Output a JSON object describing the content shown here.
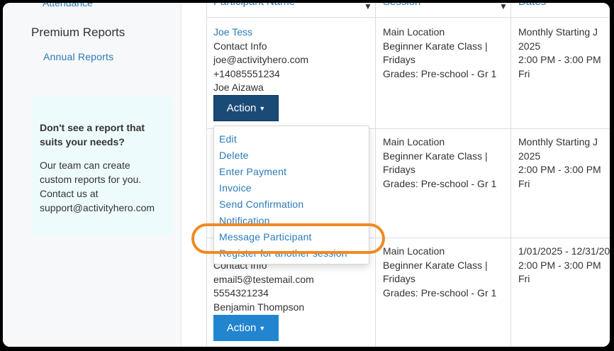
{
  "sidebar": {
    "cut_item": "Attendance",
    "heading": "Premium Reports",
    "link": "Annual Reports",
    "callout_title": "Don't see a report that suits your needs?",
    "callout_body": "Our team can create custom reports for you. Contact us at support@activityhero.com"
  },
  "table": {
    "headers": [
      "Participant Name",
      "Session",
      "Dates"
    ],
    "rows": [
      {
        "name": "Joe Tess",
        "contact_label": "Contact Info",
        "email": "joe@activityhero.com",
        "phone": "+14085551234",
        "guardian": "Joe Aizawa",
        "session_location": "Main Location",
        "session_class1": "Beginner Karate Class |",
        "session_class2": "Fridays",
        "session_grades": "Grades: Pre-school - Gr 1",
        "dates_line1": "Monthly Starting J",
        "dates_line2": "2025",
        "dates_line3": "2:00 PM - 3:00 PM",
        "dates_line4": "Fri"
      },
      {
        "session_location": "Main Location",
        "session_class1": "Beginner Karate Class |",
        "session_class2": "Fridays",
        "session_grades": "Grades: Pre-school - Gr 1",
        "dates_line1": "Monthly Starting J",
        "dates_line2": "2025",
        "dates_line3": "2:00 PM - 3:00 PM",
        "dates_line4": "Fri"
      },
      {
        "contact_label": "Contact Info",
        "email": "email5@testemail.com",
        "phone": "5554321234",
        "guardian": "Benjamin Thompson",
        "session_location": "Main Location",
        "session_class1": "Beginner Karate Class |",
        "session_class2": "Fridays",
        "session_grades": "Grades: Pre-school - Gr 1",
        "dates_line1": "1/01/2025 - 12/31/20",
        "dates_line2": "2:00 PM - 3:00 PM",
        "dates_line3": "Fri"
      }
    ],
    "action_label": "Action"
  },
  "menu": {
    "items": [
      "Edit",
      "Delete",
      "Enter Payment",
      "Invoice",
      "Send Confirmation",
      "Notification",
      "Message Participant",
      "Register for another session"
    ]
  },
  "colors": {
    "link": "#2a7ab8",
    "action_active": "#1a4a76",
    "action": "#2185d0",
    "highlight": "#f08a24"
  }
}
